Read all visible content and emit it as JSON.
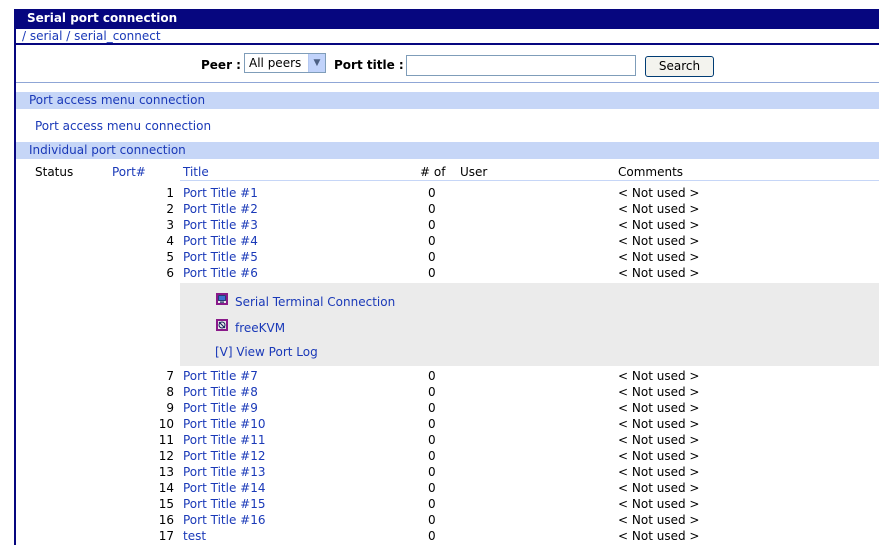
{
  "header": {
    "title": "Serial port connection"
  },
  "breadcrumb": {
    "text": "/ serial / serial_connect"
  },
  "search": {
    "peer_label": "Peer :",
    "peer_selected": "All peers",
    "port_title_label": "Port title :",
    "port_title_value": "",
    "button_label": "Search"
  },
  "access_section": {
    "header": "Port access menu connection",
    "link": "Port access menu connection"
  },
  "individual_section": {
    "header": "Individual port connection",
    "columns": {
      "status": "Status",
      "port": "Port#",
      "title": "Title",
      "count": "# of",
      "user": "User",
      "comments": "Comments"
    }
  },
  "rows_top": [
    {
      "port": "1",
      "title": "Port Title #1",
      "count": "0",
      "comment": "< Not used >"
    },
    {
      "port": "2",
      "title": "Port Title #2",
      "count": "0",
      "comment": "< Not used >"
    },
    {
      "port": "3",
      "title": "Port Title #3",
      "count": "0",
      "comment": "< Not used >"
    },
    {
      "port": "4",
      "title": "Port Title #4",
      "count": "0",
      "comment": "< Not used >"
    },
    {
      "port": "5",
      "title": "Port Title #5",
      "count": "0",
      "comment": "< Not used >"
    },
    {
      "port": "6",
      "title": "Port Title #6",
      "count": "0",
      "comment": "< Not used >"
    }
  ],
  "port_menu": {
    "serial_terminal": "Serial Terminal Connection",
    "freekvm": "freeKVM",
    "view_log": "[V] View Port Log"
  },
  "rows_bottom": [
    {
      "port": "7",
      "title": "Port Title #7",
      "count": "0",
      "comment": "< Not used >"
    },
    {
      "port": "8",
      "title": "Port Title #8",
      "count": "0",
      "comment": "< Not used >"
    },
    {
      "port": "9",
      "title": "Port Title #9",
      "count": "0",
      "comment": "< Not used >"
    },
    {
      "port": "10",
      "title": "Port Title #10",
      "count": "0",
      "comment": "< Not used >"
    },
    {
      "port": "11",
      "title": "Port Title #11",
      "count": "0",
      "comment": "< Not used >"
    },
    {
      "port": "12",
      "title": "Port Title #12",
      "count": "0",
      "comment": "< Not used >"
    },
    {
      "port": "13",
      "title": "Port Title #13",
      "count": "0",
      "comment": "< Not used >"
    },
    {
      "port": "14",
      "title": "Port Title #14",
      "count": "0",
      "comment": "< Not used >"
    },
    {
      "port": "15",
      "title": "Port Title #15",
      "count": "0",
      "comment": "< Not used >"
    },
    {
      "port": "16",
      "title": "Port Title #16",
      "count": "0",
      "comment": "< Not used >"
    },
    {
      "port": "17",
      "title": "test",
      "count": "0",
      "comment": "< Not used >"
    }
  ]
}
